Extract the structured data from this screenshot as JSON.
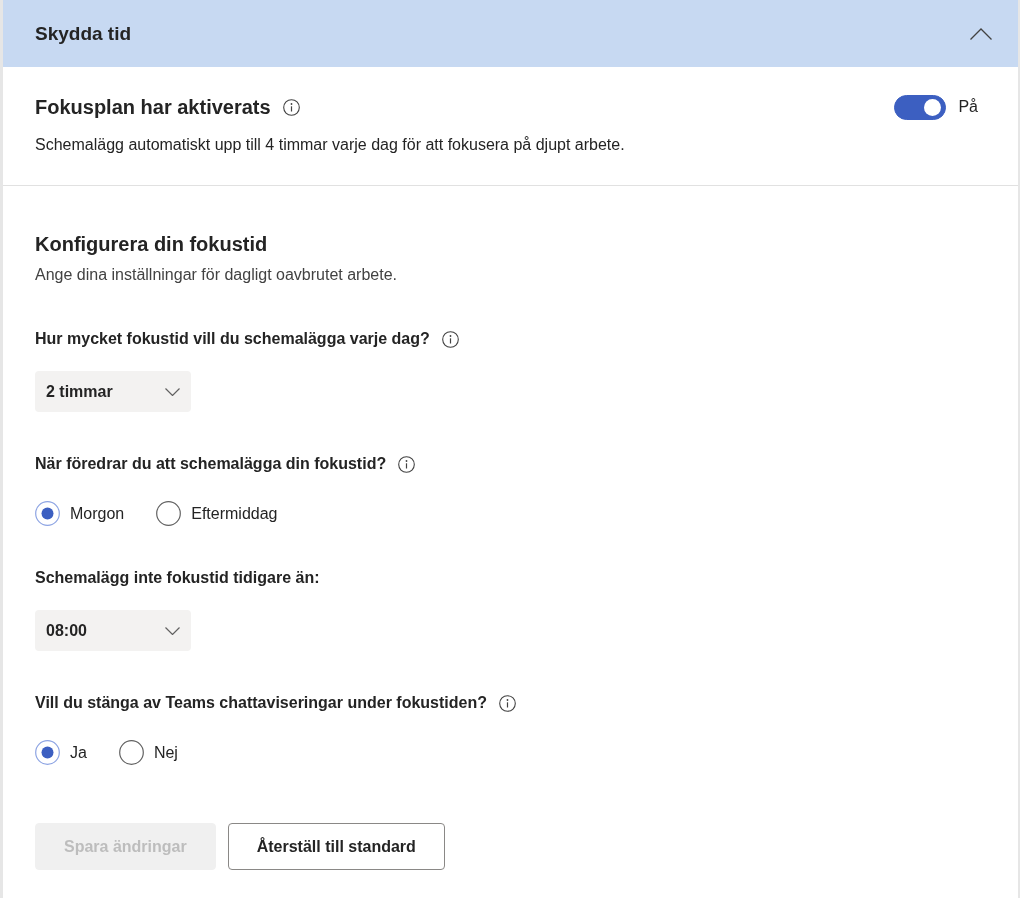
{
  "panel": {
    "title": "Skydda tid",
    "expanded": true
  },
  "focus_plan": {
    "title": "Fokusplan har aktiverats",
    "info": true,
    "on": true,
    "toggle_label": "På",
    "description": "Schemalägg automatiskt upp till 4 timmar varje dag för att fokusera på djupt arbete."
  },
  "configure": {
    "title": "Konfigurera din fokustid",
    "subtitle": "Ange dina inställningar för dagligt oavbrutet arbete.",
    "fields": [
      {
        "kind": "dropdown",
        "label": "Hur mycket fokustid vill du schemalägga varje dag?",
        "info": true,
        "value": "2 timmar"
      },
      {
        "kind": "radio",
        "label": "När föredrar du att schemalägga din fokustid?",
        "info": true,
        "options": [
          {
            "label": "Morgon",
            "selected": true
          },
          {
            "label": "Eftermiddag",
            "selected": false
          }
        ]
      },
      {
        "kind": "dropdown",
        "label": "Schemalägg inte fokustid tidigare än:",
        "info": false,
        "value": "08:00"
      },
      {
        "kind": "radio",
        "label": "Vill du stänga av Teams chattaviseringar under fokustiden?",
        "info": true,
        "options": [
          {
            "label": "Ja",
            "selected": true
          },
          {
            "label": "Nej",
            "selected": false
          }
        ]
      }
    ]
  },
  "buttons": [
    {
      "label": "Spara ändringar",
      "disabled": true
    },
    {
      "label": "Återställ till standard",
      "disabled": false
    }
  ]
}
